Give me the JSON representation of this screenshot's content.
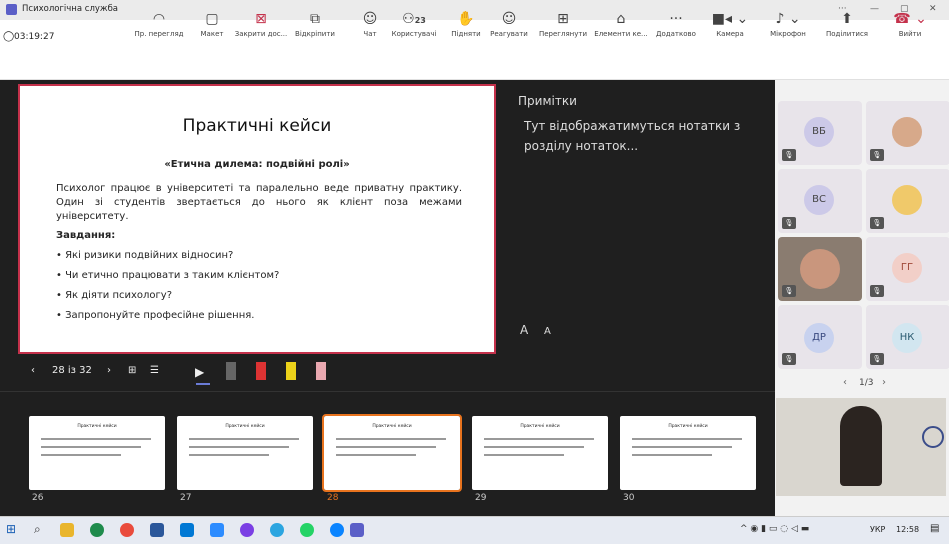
{
  "window": {
    "title": "Психологічна служба",
    "controls": [
      "···",
      "—",
      "▢",
      "✕"
    ]
  },
  "toolbar": {
    "timer": "03:19:27",
    "items": [
      {
        "label": "Пр. перегляд",
        "icon": "view-icon"
      },
      {
        "label": "Макет",
        "icon": "layout-icon"
      },
      {
        "label": "Закрити дос...",
        "icon": "stop-share-icon"
      },
      {
        "label": "Відкріпити",
        "icon": "undock-icon"
      },
      {
        "label": "Чат",
        "icon": "chat-icon"
      },
      {
        "label": "Користувачі",
        "icon": "people-icon",
        "badge": "23"
      },
      {
        "label": "Підняти",
        "icon": "raise-hand-icon"
      },
      {
        "label": "Реагувати",
        "icon": "react-icon"
      },
      {
        "label": "Переглянути",
        "icon": "rooms-icon"
      },
      {
        "label": "Елементи ке...",
        "icon": "apps-icon"
      },
      {
        "label": "Додатково",
        "icon": "more-icon"
      },
      {
        "label": "Камера",
        "icon": "camera-icon"
      },
      {
        "label": "Мікрофон",
        "icon": "mic-icon"
      },
      {
        "label": "Поділитися",
        "icon": "share-icon"
      },
      {
        "label": "Вийти",
        "icon": "leave-icon"
      }
    ]
  },
  "slide": {
    "title": "Практичні кейси",
    "subtitle": "«Етична дилема: подвійні ролі»",
    "paragraph": "Психолог працює в університеті та паралельно веде приватну практику. Один зі студентів звертається до нього як клієнт поза межами університету.",
    "tasks_label": "Завдання:",
    "bullets": [
      "• Які ризики подвійних відносин?",
      "• Чи етично працювати з таким клієнтом?",
      "• Як діяти психологу?",
      "• Запропонуйте професійне рішення."
    ]
  },
  "notes": {
    "title": "Примітки",
    "text": "Тут відображатимуться нотатки з розділу нотаток..."
  },
  "font_controls": [
    "A",
    "A"
  ],
  "nav": {
    "prev": "‹",
    "page": "28 із 32",
    "next": "›"
  },
  "thumbs": [
    {
      "num": "26",
      "title": "Практичні кейси"
    },
    {
      "num": "27",
      "title": "Практичні кейси"
    },
    {
      "num": "28",
      "title": "Практичні кейси"
    },
    {
      "num": "29",
      "title": "Практичні кейси"
    },
    {
      "num": "30",
      "title": "Практичні кейси"
    }
  ],
  "participants": [
    {
      "initials": "ВБ"
    },
    {
      "initials": ""
    },
    {
      "initials": "ВС"
    },
    {
      "initials": ""
    },
    {
      "initials": ""
    },
    {
      "initials": "ГГ"
    },
    {
      "initials": "ДР"
    },
    {
      "initials": "НК"
    }
  ],
  "gallery_nav": {
    "prev": "‹",
    "page": "1/3",
    "next": "›"
  },
  "taskbar": {
    "lang": "УКР",
    "time": "12:58"
  },
  "colors": {
    "accent": "#c4314b",
    "selected": "#e8731e",
    "leave": "#c4314b"
  }
}
